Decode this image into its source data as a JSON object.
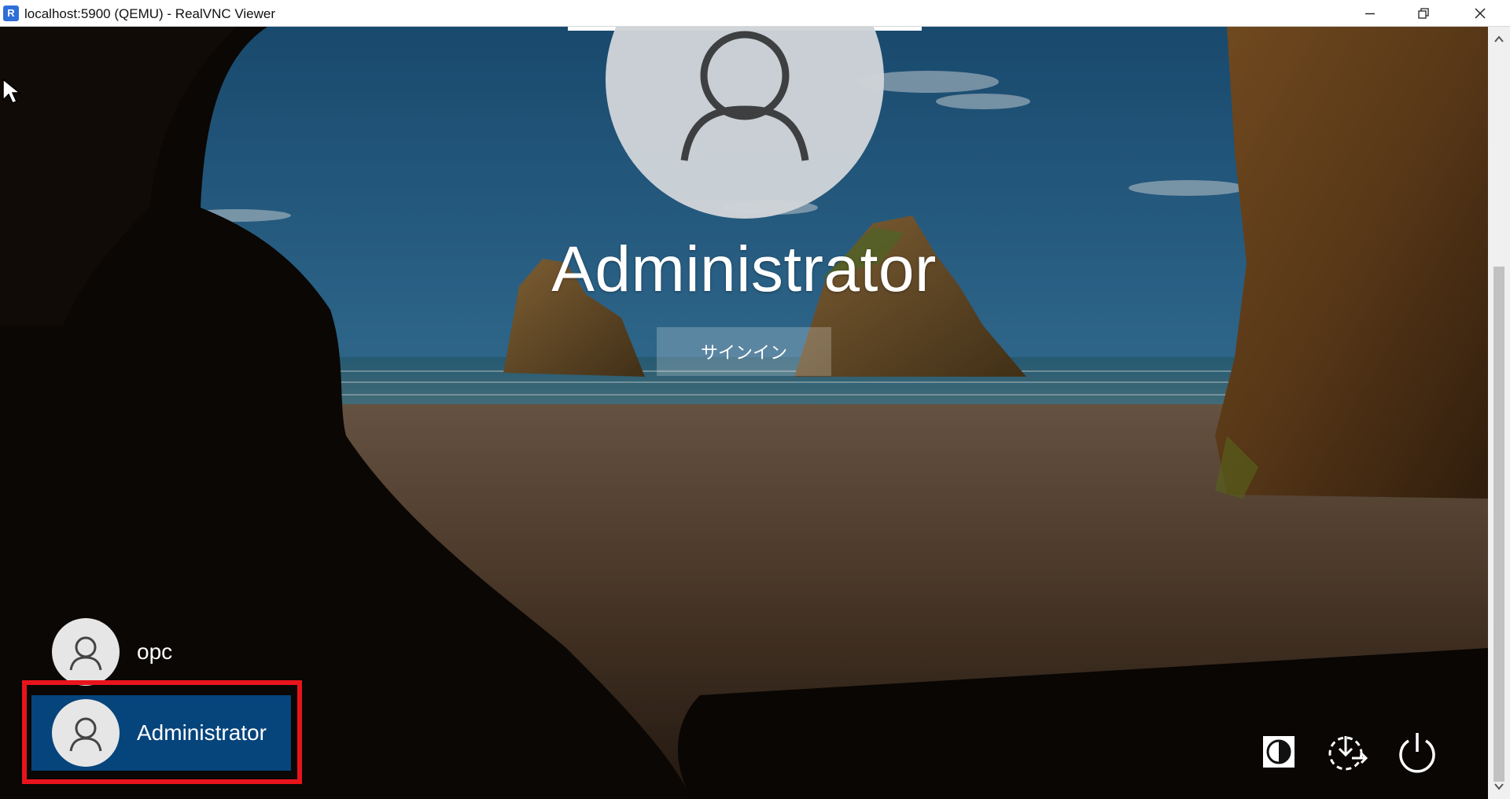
{
  "window": {
    "title": "localhost:5900 (QEMU) - RealVNC Viewer",
    "app_icon_text": "R"
  },
  "lock_screen": {
    "selected_user_name": "Administrator",
    "signin_label": "サインイン"
  },
  "users": [
    {
      "name": "opc",
      "selected": false
    },
    {
      "name": "Administrator",
      "selected": true
    }
  ],
  "system_icons": [
    "ease-of-access-icon",
    "network-icon",
    "power-icon"
  ],
  "colors": {
    "selected_user_bg": "#06447c",
    "highlight_border": "#e8141c"
  }
}
